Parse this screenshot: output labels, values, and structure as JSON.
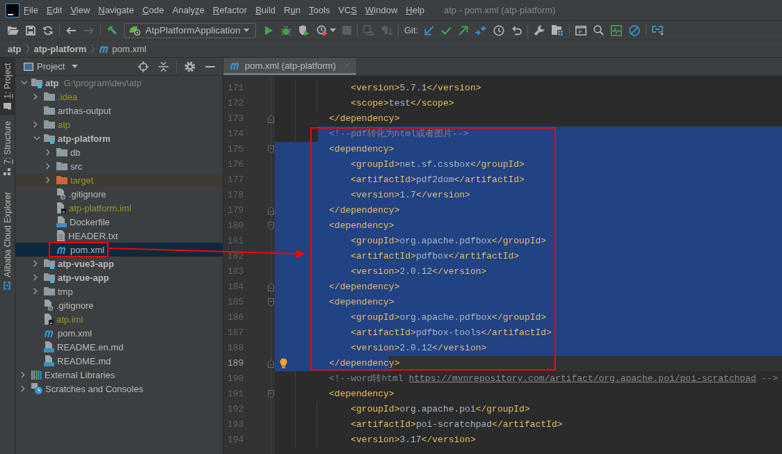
{
  "menu": {
    "items": [
      {
        "key": "F",
        "tail": "ile"
      },
      {
        "key": "E",
        "tail": "dit"
      },
      {
        "key": "V",
        "tail": "iew"
      },
      {
        "key": "N",
        "tail": "avigate"
      },
      {
        "key": "C",
        "tail": "ode"
      },
      {
        "head": "Analy",
        "key": "z",
        "tail": "e"
      },
      {
        "key": "R",
        "tail": "efactor"
      },
      {
        "key": "B",
        "tail": "uild"
      },
      {
        "head": "R",
        "key": "u",
        "tail": "n"
      },
      {
        "key": "T",
        "tail": "ools"
      },
      {
        "head": "VC",
        "key": "S"
      },
      {
        "key": "W",
        "tail": "indow"
      },
      {
        "key": "H",
        "tail": "elp"
      }
    ]
  },
  "window": {
    "title": "atp - pom.xml (atp-platform)"
  },
  "toolbar": {
    "file_actions": [
      {
        "disabled": false
      },
      {
        "disabled": false
      },
      {
        "disabled": false
      }
    ],
    "navigation": [
      {
        "disabled": false
      },
      {
        "disabled": true
      }
    ],
    "build": [
      {
        "disabled": false
      }
    ],
    "run_config": "AtpPlatformApplication",
    "run_actions": [
      {
        "disabled": false
      },
      {
        "disabled": false
      },
      {
        "disabled": false
      },
      {
        "disabled": false
      },
      {
        "disabled": true
      }
    ],
    "deploy_actions": [
      {
        "disabled": true
      },
      {
        "disabled": true
      }
    ],
    "vcs_label": "Git:",
    "vcs_actions": [
      {
        "disabled": false
      },
      {
        "disabled": false
      },
      {
        "disabled": false
      },
      {
        "disabled": false
      },
      {
        "disabled": false
      },
      {
        "disabled": false
      }
    ],
    "tool_actions": [
      {
        "disabled": false
      },
      {
        "disabled": false
      }
    ],
    "view_actions": [
      {
        "disabled": false
      },
      {
        "disabled": false
      },
      {
        "disabled": false
      },
      {
        "disabled": false
      }
    ],
    "cloud_actions": [
      {
        "disabled": false
      }
    ]
  },
  "breadcrumbs": [
    {
      "label": "atp",
      "kind": "module"
    },
    {
      "label": "atp-platform",
      "kind": "module"
    },
    {
      "label": "pom.xml",
      "kind": "maven_file"
    }
  ],
  "tool_stripe": [
    {
      "key": "1",
      "tail": ": Project",
      "selected": true
    },
    {
      "key": "7",
      "tail": ": Structure",
      "selected": false
    },
    {
      "head": "Alibaba Cloud Explorer",
      "selected": false
    }
  ],
  "project": {
    "title": "Project",
    "tree": [
      {
        "name": "atp",
        "kind": "module",
        "hint": "G:\\program\\dev\\atp",
        "expanded": true,
        "selected": false,
        "ignored": false,
        "outlined": false,
        "children": [
          {
            "name": ".idea",
            "kind": "folder",
            "expanded": false,
            "selected": false,
            "ignored": true,
            "outlined": false
          },
          {
            "name": "arthas-output",
            "kind": "folder",
            "selected": false,
            "ignored": false,
            "outlined": false
          },
          {
            "name": "atp",
            "kind": "folder",
            "expanded": false,
            "selected": false,
            "ignored": true,
            "outlined": false
          },
          {
            "name": "atp-platform",
            "kind": "module",
            "expanded": true,
            "selected": false,
            "ignored": false,
            "outlined": false,
            "children": [
              {
                "name": "db",
                "kind": "folder",
                "expanded": false,
                "selected": false,
                "ignored": false,
                "outlined": false
              },
              {
                "name": "src",
                "kind": "folder",
                "expanded": false,
                "selected": false,
                "ignored": false,
                "outlined": false
              },
              {
                "name": "target",
                "kind": "excluded_folder",
                "expanded": false,
                "selected": false,
                "ignored": true,
                "outlined": false
              },
              {
                "name": ".gitignore",
                "kind": "ignore_file",
                "selected": false,
                "ignored": false,
                "outlined": false
              },
              {
                "name": "atp-platform.iml",
                "kind": "iml_file",
                "selected": false,
                "ignored": true,
                "outlined": false
              },
              {
                "name": "Dockerfile",
                "kind": "docker_file",
                "selected": false,
                "ignored": false,
                "outlined": false
              },
              {
                "name": "HEADER.txt",
                "kind": "text_file",
                "selected": false,
                "ignored": false,
                "outlined": false
              },
              {
                "name": "pom.xml",
                "kind": "maven_file",
                "selected": true,
                "ignored": false,
                "outlined": true
              }
            ]
          },
          {
            "name": "atp-vue3-app",
            "kind": "module",
            "expanded": false,
            "selected": false,
            "ignored": false,
            "outlined": false
          },
          {
            "name": "atp-vue-app",
            "kind": "module",
            "expanded": false,
            "selected": false,
            "ignored": false,
            "outlined": false
          },
          {
            "name": "tmp",
            "kind": "folder",
            "expanded": false,
            "selected": false,
            "ignored": false,
            "outlined": false
          },
          {
            "name": ".gitignore",
            "kind": "ignore_file",
            "selected": false,
            "ignored": false,
            "outlined": false
          },
          {
            "name": "atp.iml",
            "kind": "iml_file",
            "selected": false,
            "ignored": true,
            "outlined": false
          },
          {
            "name": "pom.xml",
            "kind": "maven_file",
            "selected": false,
            "ignored": false,
            "outlined": false
          },
          {
            "name": "README.en.md",
            "kind": "markdown_file",
            "selected": false,
            "ignored": false,
            "outlined": false
          },
          {
            "name": "README.md",
            "kind": "markdown_file",
            "selected": false,
            "ignored": false,
            "outlined": false
          }
        ]
      },
      {
        "name": "External Libraries",
        "kind": "libraries",
        "expanded": false,
        "selected": false,
        "ignored": false,
        "outlined": false
      },
      {
        "name": "Scratches and Consoles",
        "kind": "scratches",
        "expanded": false,
        "selected": false,
        "ignored": false,
        "outlined": false
      }
    ]
  },
  "editor": {
    "tabs": [
      {
        "label": "pom.xml (atp-platform)",
        "kind": "maven_file",
        "selected": true
      }
    ],
    "blocks": [
      {
        "outlined": false,
        "lines": [
          {
            "number": "171",
            "kind": "plain",
            "tokens": [
              {
                "kind": "tag",
                "text": "            <version>"
              },
              {
                "kind": "value",
                "text": "5.7.1"
              },
              {
                "kind": "tag",
                "text": "</version>"
              }
            ],
            "selected": false,
            "caret": false
          },
          {
            "number": "172",
            "kind": "plain",
            "tokens": [
              {
                "kind": "tag",
                "text": "            <scope>"
              },
              {
                "kind": "value",
                "text": "test"
              },
              {
                "kind": "tag",
                "text": "</scope>"
              }
            ],
            "selected": false,
            "caret": false
          },
          {
            "number": "173",
            "kind": "fold_end",
            "tokens": [
              {
                "kind": "tag",
                "text": "        </dependency>"
              }
            ],
            "selected": false,
            "caret": false
          }
        ]
      },
      {
        "outlined": true,
        "lines": [
          {
            "number": "174",
            "kind": "plain",
            "tokens": [
              {
                "kind": "comment",
                "text": "        <!--pdf转化为html或者图片-->"
              }
            ],
            "selected": true,
            "caret": false
          },
          {
            "number": "175",
            "kind": "fold_start",
            "tokens": [
              {
                "kind": "tag",
                "text": "        <dependency>"
              }
            ],
            "selected": true,
            "caret": false
          },
          {
            "number": "176",
            "kind": "plain",
            "tokens": [
              {
                "kind": "tag",
                "text": "            <groupId>"
              },
              {
                "kind": "value",
                "text": "net.sf.cssbox"
              },
              {
                "kind": "tag",
                "text": "</groupId>"
              }
            ],
            "selected": true,
            "caret": false
          },
          {
            "number": "177",
            "kind": "plain",
            "tokens": [
              {
                "kind": "tag",
                "text": "            <artifactId>"
              },
              {
                "kind": "value",
                "text": "pdf2dom"
              },
              {
                "kind": "tag",
                "text": "</artifactId>"
              }
            ],
            "selected": true,
            "caret": false
          },
          {
            "number": "178",
            "kind": "plain",
            "tokens": [
              {
                "kind": "tag",
                "text": "            <version>"
              },
              {
                "kind": "value",
                "text": "1.7"
              },
              {
                "kind": "tag",
                "text": "</version>"
              }
            ],
            "selected": true,
            "caret": false
          },
          {
            "number": "179",
            "kind": "fold_end",
            "tokens": [
              {
                "kind": "tag",
                "text": "        </dependency>"
              }
            ],
            "selected": true,
            "caret": false
          },
          {
            "number": "180",
            "kind": "fold_start",
            "tokens": [
              {
                "kind": "tag",
                "text": "        <dependency>"
              }
            ],
            "selected": true,
            "caret": false
          },
          {
            "number": "181",
            "kind": "plain",
            "tokens": [
              {
                "kind": "tag",
                "text": "            <groupId>"
              },
              {
                "kind": "value",
                "text": "org.apache.pdfbox"
              },
              {
                "kind": "tag",
                "text": "</groupId>"
              }
            ],
            "selected": true,
            "caret": false
          },
          {
            "number": "182",
            "kind": "plain",
            "tokens": [
              {
                "kind": "tag",
                "text": "            <artifactId>"
              },
              {
                "kind": "value",
                "text": "pdfbox"
              },
              {
                "kind": "tag",
                "text": "</artifactId>"
              }
            ],
            "selected": true,
            "caret": false
          },
          {
            "number": "183",
            "kind": "plain",
            "tokens": [
              {
                "kind": "tag",
                "text": "            <version>"
              },
              {
                "kind": "value",
                "text": "2.0.12"
              },
              {
                "kind": "tag",
                "text": "</version>"
              }
            ],
            "selected": true,
            "caret": false
          },
          {
            "number": "184",
            "kind": "fold_end",
            "tokens": [
              {
                "kind": "tag",
                "text": "        </dependency>"
              }
            ],
            "selected": true,
            "caret": false
          },
          {
            "number": "185",
            "kind": "fold_start",
            "tokens": [
              {
                "kind": "tag",
                "text": "        <dependency>"
              }
            ],
            "selected": true,
            "caret": false
          },
          {
            "number": "186",
            "kind": "plain",
            "tokens": [
              {
                "kind": "tag",
                "text": "            <groupId>"
              },
              {
                "kind": "value",
                "text": "org.apache.pdfbox"
              },
              {
                "kind": "tag",
                "text": "</groupId>"
              }
            ],
            "selected": true,
            "caret": false
          },
          {
            "number": "187",
            "kind": "plain",
            "tokens": [
              {
                "kind": "tag",
                "text": "            <artifactId>"
              },
              {
                "kind": "value",
                "text": "pdfbox-tools"
              },
              {
                "kind": "tag",
                "text": "</artifactId>"
              }
            ],
            "selected": true,
            "caret": false
          },
          {
            "number": "188",
            "kind": "plain",
            "tokens": [
              {
                "kind": "tag",
                "text": "            <version>"
              },
              {
                "kind": "value",
                "text": "2.0.12"
              },
              {
                "kind": "tag",
                "text": "</version>"
              }
            ],
            "selected": true,
            "caret": false
          },
          {
            "number": "189",
            "kind": "fold_end",
            "tokens": [
              {
                "kind": "tag",
                "text": "        </dependency>"
              }
            ],
            "selected": true,
            "caret": true
          }
        ]
      },
      {
        "outlined": false,
        "lines": [
          {
            "number": "190",
            "kind": "plain",
            "tokens": [
              {
                "kind": "comment",
                "text": "        <!--word转html "
              },
              {
                "kind": "link",
                "text": "https://mvnrepository.com/artifact/org.apache.poi/poi-scratchpad"
              },
              {
                "kind": "comment",
                "text": " -->"
              }
            ],
            "selected": false,
            "caret": false
          },
          {
            "number": "191",
            "kind": "fold_start",
            "tokens": [
              {
                "kind": "tag",
                "text": "        <dependency>"
              }
            ],
            "selected": false,
            "caret": false
          },
          {
            "number": "192",
            "kind": "plain",
            "tokens": [
              {
                "kind": "tag",
                "text": "            <groupId>"
              },
              {
                "kind": "value",
                "text": "org.apache.poi"
              },
              {
                "kind": "tag",
                "text": "</groupId>"
              }
            ],
            "selected": false,
            "caret": false
          },
          {
            "number": "193",
            "kind": "plain",
            "tokens": [
              {
                "kind": "tag",
                "text": "            <artifactId>"
              },
              {
                "kind": "value",
                "text": "poi-scratchpad"
              },
              {
                "kind": "tag",
                "text": "</artifactId>"
              }
            ],
            "selected": false,
            "caret": false
          },
          {
            "number": "194",
            "kind": "plain",
            "tokens": [
              {
                "kind": "tag",
                "text": "            <version>"
              },
              {
                "kind": "value",
                "text": "3.17"
              },
              {
                "kind": "tag",
                "text": "</version>"
              }
            ],
            "selected": false,
            "caret": false
          }
        ]
      }
    ]
  },
  "annotation_arrow": true
}
